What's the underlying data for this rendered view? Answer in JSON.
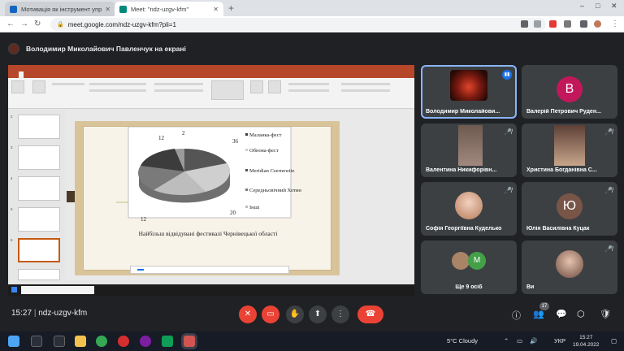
{
  "browser": {
    "tabs": [
      {
        "title": "Мотивація як інструмент упра",
        "favicon_color": "#1565c0"
      },
      {
        "title": "Meet: \"ndz-uzgv-kfm\"",
        "favicon_color": "#00897b"
      }
    ],
    "new_tab": "+",
    "url": "meet.google.com/ndz-uzgv-kfm?pli=1"
  },
  "meet": {
    "presenting_banner": "Володимир Миколайович Павленчук на екрані",
    "meeting_code": "ndz-uzgv-kfm",
    "time": "15:27",
    "participants_count": "17",
    "tiles": [
      {
        "name": "Володимир Миколайови...",
        "type": "photo",
        "color": "#6b1d12",
        "speaking": true
      },
      {
        "name": "Валерій Петрович Руден...",
        "type": "letter",
        "letter": "В",
        "color": "#c2185b"
      },
      {
        "name": "Валентина Никифорівн...",
        "type": "photo",
        "color": "#8d6e63"
      },
      {
        "name": "Христина Богданівна С...",
        "type": "photo",
        "color": "#6d4c41"
      },
      {
        "name": "Софія Георгіївна Куделько",
        "type": "photo",
        "color": "#d7a98c"
      },
      {
        "name": "Юлія Василівна Куцак",
        "type": "letter",
        "letter": "Ю",
        "color": "#795548"
      },
      {
        "name": "Ще 9 осіб",
        "type": "group",
        "letter": "M",
        "color": "#43a047"
      },
      {
        "name": "Ви",
        "type": "photo",
        "color": "#a1887f"
      }
    ]
  },
  "slide": {
    "caption": "Найбільш відвідувані фестивалі Чернівецької області",
    "labels": [
      "12",
      "2",
      "36",
      "12",
      "20"
    ],
    "legend": [
      "Маланка-фест",
      "Обнова-фест",
      "Meridian Czernowitz",
      "Середньовічний Хотин",
      "Інші"
    ]
  },
  "taskbar": {
    "weather": "5°C  Cloudy",
    "lang": "УКР",
    "clock_time": "15:27",
    "clock_date": "19.04.2022"
  }
}
